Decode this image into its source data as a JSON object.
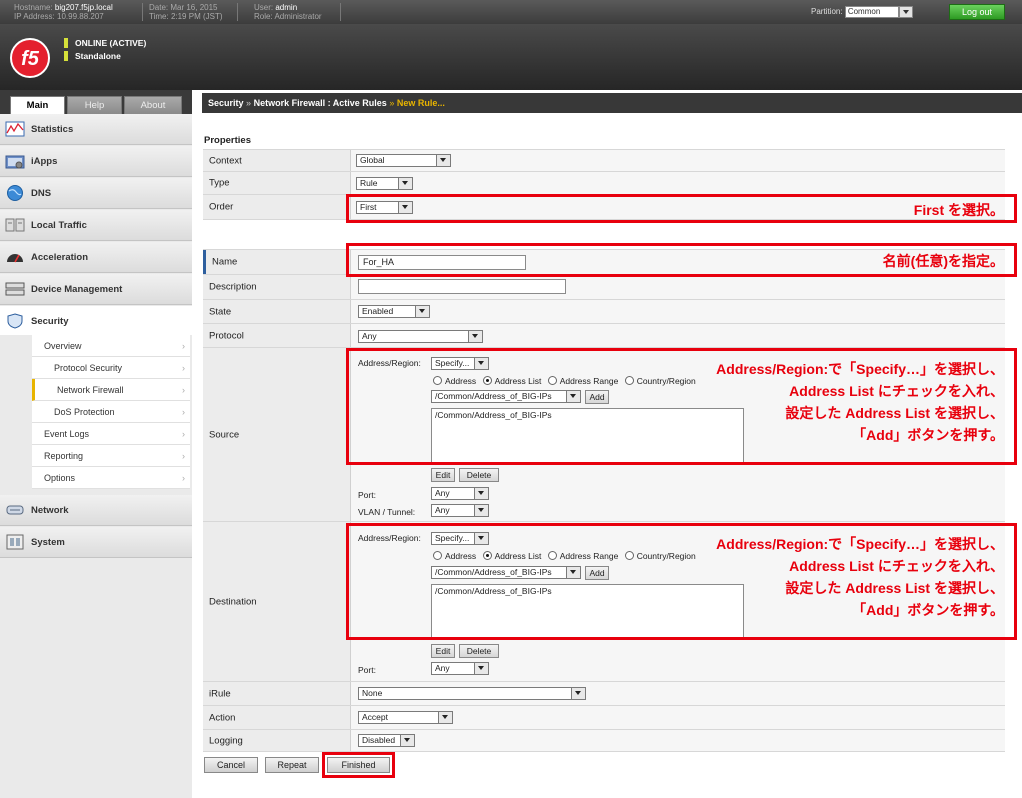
{
  "topbar": {
    "hostname_label": "Hostname:",
    "hostname": "big207.f5jp.local",
    "ip_label": "IP Address:",
    "ip": "10.99.88.207",
    "date_label": "Date:",
    "date": "Mar 16, 2015",
    "time_label": "Time:",
    "time": "2:19 PM (JST)",
    "user_label": "User:",
    "user": "admin",
    "role_label": "Role:",
    "role": "Administrator",
    "partition_label": "Partition:",
    "partition_value": "Common",
    "logout_label": "Log out"
  },
  "header": {
    "logo_text": "f5",
    "status": "ONLINE (ACTIVE)",
    "mode": "Standalone"
  },
  "sidebar": {
    "tabs": [
      {
        "label": "Main"
      },
      {
        "label": "Help"
      },
      {
        "label": "About"
      }
    ],
    "nav": [
      {
        "label": "Statistics"
      },
      {
        "label": "iApps"
      },
      {
        "label": "DNS"
      },
      {
        "label": "Local Traffic"
      },
      {
        "label": "Acceleration"
      },
      {
        "label": "Device Management"
      },
      {
        "label": "Security"
      },
      {
        "label": "Network"
      },
      {
        "label": "System"
      }
    ],
    "security_sub": [
      {
        "label": "Overview"
      },
      {
        "label": "Protocol Security"
      },
      {
        "label": "Network Firewall"
      },
      {
        "label": "DoS Protection"
      },
      {
        "label": "Event Logs"
      },
      {
        "label": "Reporting"
      },
      {
        "label": "Options"
      }
    ]
  },
  "breadcrumb": {
    "part1": "Security",
    "sep": "»",
    "part2": "Network Firewall : Active Rules",
    "current": "New Rule..."
  },
  "form": {
    "section_title": "Properties",
    "context_label": "Context",
    "context_value": "Global",
    "type_label": "Type",
    "type_value": "Rule",
    "order_label": "Order",
    "order_value": "First",
    "name_label": "Name",
    "name_value": "For_HA",
    "description_label": "Description",
    "description_value": "",
    "state_label": "State",
    "state_value": "Enabled",
    "protocol_label": "Protocol",
    "protocol_value": "Any",
    "source_label": "Source",
    "destination_label": "Destination",
    "address_region_label": "Address/Region:",
    "address_region_value": "Specify...",
    "radio_address": "Address",
    "radio_address_list": "Address List",
    "radio_address_range": "Address Range",
    "radio_country": "Country/Region",
    "address_list_select": "/Common/Address_of_BIG-IPs",
    "add_button": "Add",
    "list_entry": "/Common/Address_of_BIG-IPs",
    "edit_button": "Edit",
    "delete_button": "Delete",
    "port_label": "Port:",
    "port_value": "Any",
    "vlan_label": "VLAN / Tunnel:",
    "vlan_value": "Any",
    "irule_label": "iRule",
    "irule_value": "None",
    "action_label": "Action",
    "action_value": "Accept",
    "logging_label": "Logging",
    "logging_value": "Disabled"
  },
  "buttons": {
    "cancel": "Cancel",
    "repeat": "Repeat",
    "finished": "Finished"
  },
  "annotations": {
    "order_note": "First を選択。",
    "name_note": "名前(任意)を指定。",
    "source_note_1": "Address/Region:で「Specify…」を選択し、",
    "source_note_2": "Address List にチェックを入れ、",
    "source_note_3": "設定した Address List を選択し、",
    "source_note_4": "「Add」ボタンを押す。",
    "dest_note_1": "Address/Region:で「Specify…」を選択し、",
    "dest_note_2": "Address List にチェックを入れ、",
    "dest_note_3": "設定した Address List を選択し、",
    "dest_note_4": "「Add」ボタンを押す。"
  },
  "colors": {
    "annotation": "#e8000d",
    "accent": "#e8b400",
    "logout": "#2e9a23"
  }
}
